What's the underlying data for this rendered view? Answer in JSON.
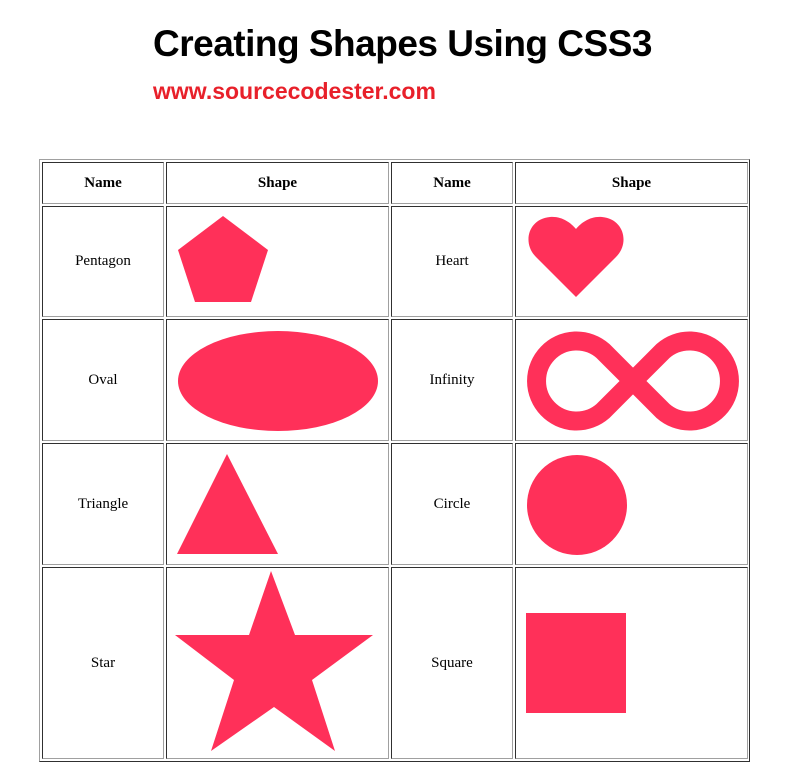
{
  "page": {
    "title": "Creating Shapes Using CSS3",
    "subtitle": "www.sourcecodester.com"
  },
  "table": {
    "headers": [
      "Name",
      "Shape",
      "Name",
      "Shape"
    ],
    "rows": [
      {
        "left_name": "Pentagon",
        "left_shape": "pentagon",
        "right_name": "Heart",
        "right_shape": "heart"
      },
      {
        "left_name": "Oval",
        "left_shape": "oval",
        "right_name": "Infinity",
        "right_shape": "infinity"
      },
      {
        "left_name": "Triangle",
        "left_shape": "triangle",
        "right_name": "Circle",
        "right_shape": "circle"
      },
      {
        "left_name": "Star",
        "left_shape": "star",
        "right_name": "Square",
        "right_shape": "square"
      }
    ]
  },
  "colors": {
    "shape_fill": "#FF3059",
    "subtitle": "#E8202A"
  }
}
